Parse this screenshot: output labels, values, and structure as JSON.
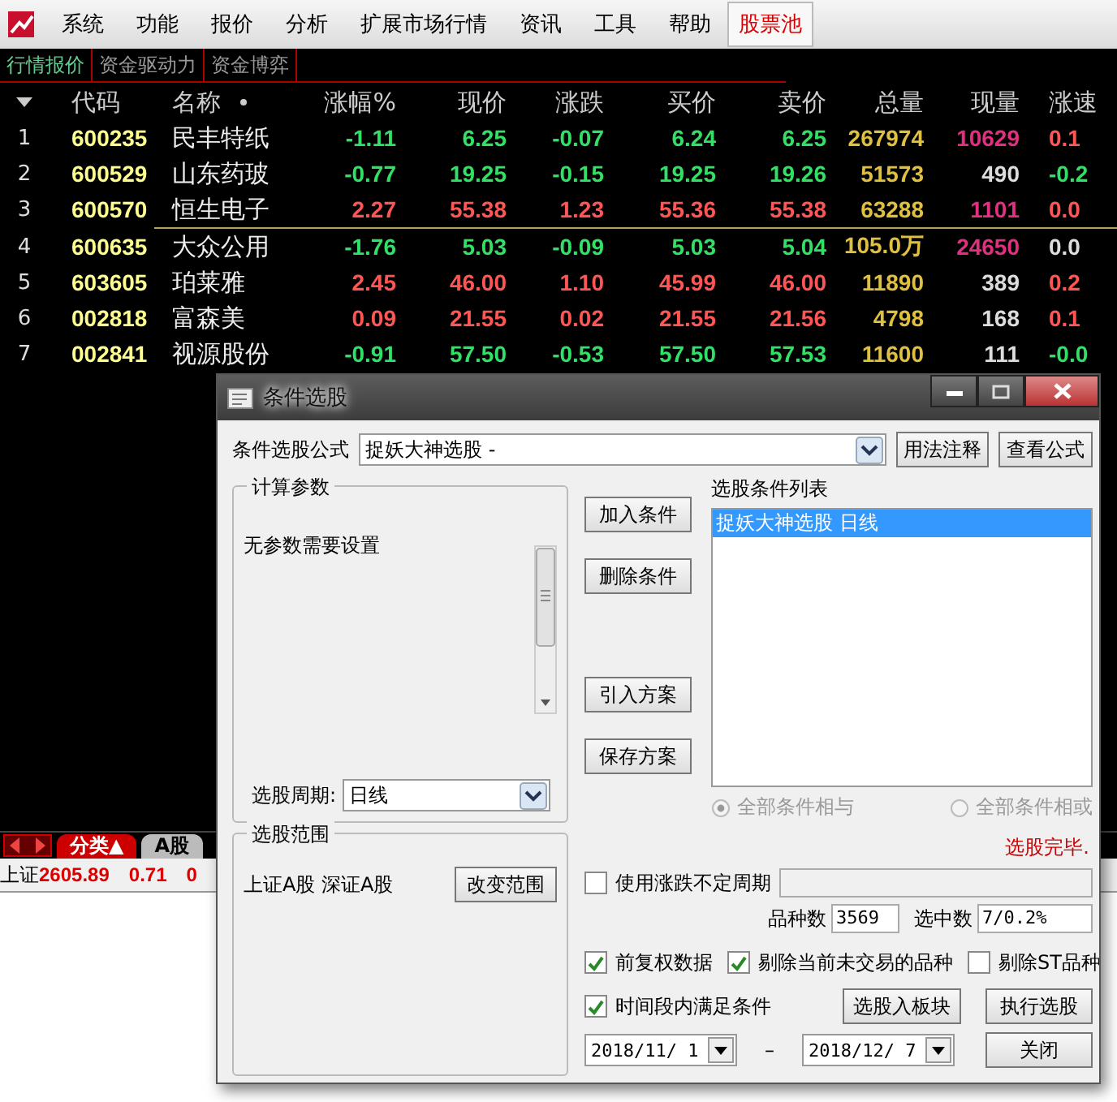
{
  "menu": [
    {
      "label": "系统",
      "kind": "normal"
    },
    {
      "label": "功能",
      "kind": "normal"
    },
    {
      "label": "报价",
      "kind": "normal"
    },
    {
      "label": "分析",
      "kind": "normal"
    },
    {
      "label": "扩展市场行情",
      "kind": "normal"
    },
    {
      "label": "资讯",
      "kind": "normal"
    },
    {
      "label": "工具",
      "kind": "normal"
    },
    {
      "label": "帮助",
      "kind": "normal"
    },
    {
      "label": "股票池",
      "kind": "highlight"
    }
  ],
  "tabs": [
    {
      "label": "行情报价",
      "selected": true
    },
    {
      "label": "资金驱动力",
      "selected": false
    },
    {
      "label": "资金博弈",
      "selected": false
    }
  ],
  "table": {
    "columns": [
      "代码",
      "名称",
      "涨幅%",
      "现价",
      "涨跌",
      "买价",
      "卖价",
      "总量",
      "现量",
      "涨速"
    ],
    "rows": [
      {
        "rank": "1",
        "code": "600235",
        "name": "民丰特纸",
        "change_pct": "-1.11",
        "price": "6.25",
        "change": "-0.07",
        "bid": "6.24",
        "ask": "6.25",
        "volume": "267974",
        "current_volume": {
          "text": "10629",
          "color": "#e0307f"
        },
        "speed": {
          "text": "0.1",
          "color": "#ff5555"
        },
        "color": "#33e066",
        "separator_below": false
      },
      {
        "rank": "2",
        "code": "600529",
        "name": "山东药玻",
        "change_pct": "-0.77",
        "price": "19.25",
        "change": "-0.15",
        "bid": "19.25",
        "ask": "19.26",
        "volume": "51573",
        "current_volume": {
          "text": "490",
          "color": "#dddddd"
        },
        "speed": {
          "text": "-0.2",
          "color": "#33e066"
        },
        "color": "#33e066",
        "separator_below": false
      },
      {
        "rank": "3",
        "code": "600570",
        "name": "恒生电子",
        "change_pct": "2.27",
        "price": "55.38",
        "change": "1.23",
        "bid": "55.36",
        "ask": "55.38",
        "volume": "63288",
        "current_volume": {
          "text": "1101",
          "color": "#e0307f"
        },
        "speed": {
          "text": "0.0",
          "color": "#ff5555"
        },
        "color": "#ff5555",
        "separator_below": true
      },
      {
        "rank": "4",
        "code": "600635",
        "name": "大众公用",
        "change_pct": "-1.76",
        "price": "5.03",
        "change": "-0.09",
        "bid": "5.03",
        "ask": "5.04",
        "volume": "105.0万",
        "current_volume": {
          "text": "24650",
          "color": "#e0307f"
        },
        "speed": {
          "text": "0.0",
          "color": "#dddddd"
        },
        "color": "#33e066",
        "separator_below": false
      },
      {
        "rank": "5",
        "code": "603605",
        "name": "珀莱雅",
        "change_pct": "2.45",
        "price": "46.00",
        "change": "1.10",
        "bid": "45.99",
        "ask": "46.00",
        "volume": "11890",
        "current_volume": {
          "text": "389",
          "color": "#dddddd"
        },
        "speed": {
          "text": "0.2",
          "color": "#ff5555"
        },
        "color": "#ff5555",
        "separator_below": false
      },
      {
        "rank": "6",
        "code": "002818",
        "name": "富森美",
        "change_pct": "0.09",
        "price": "21.55",
        "change": "0.02",
        "bid": "21.55",
        "ask": "21.56",
        "volume": "4798",
        "current_volume": {
          "text": "168",
          "color": "#dddddd"
        },
        "speed": {
          "text": "0.1",
          "color": "#ff5555"
        },
        "color": "#ff5555",
        "separator_below": false
      },
      {
        "rank": "7",
        "code": "002841",
        "name": "视源股份",
        "change_pct": "-0.91",
        "price": "57.50",
        "change": "-0.53",
        "bid": "57.50",
        "ask": "57.53",
        "volume": "11600",
        "current_volume": {
          "text": "111",
          "color": "#dddddd"
        },
        "speed": {
          "text": "-0.0",
          "color": "#33e066"
        },
        "color": "#33e066",
        "separator_below": false
      }
    ]
  },
  "bottom_tabs": [
    {
      "label": "分类▲",
      "selected": true
    },
    {
      "label": "A股",
      "selected": false
    }
  ],
  "index_line": {
    "name": "上证",
    "value": "2605.89",
    "change": "0.71",
    "column_3": "0"
  },
  "dialog": {
    "title": "条件选股",
    "formula_label": "条件选股公式",
    "formula_value": "捉妖大神选股 -",
    "usage_button": "用法注释",
    "view_button": "查看公式",
    "params_group": {
      "title": "计算参数",
      "text": "无参数需要设置",
      "period_label": "选股周期:",
      "period_value": "日线"
    },
    "scope_group": {
      "title": "选股范围",
      "text": "上证A股 深证A股",
      "button": "改变范围"
    },
    "side_buttons": [
      "加入条件",
      "删除条件",
      "引入方案",
      "保存方案"
    ],
    "list_label": "选股条件列表",
    "list_items": [
      {
        "label": "捉妖大神选股   日线",
        "selected": true
      }
    ],
    "radios": [
      {
        "label": "全部条件相与",
        "selected": true,
        "disabled": true
      },
      {
        "label": "全部条件相或",
        "selected": false,
        "disabled": true
      }
    ],
    "status": "选股完毕.",
    "variable_period": {
      "label": "使用涨跌不定周期",
      "checked": false
    },
    "count_label": "品种数",
    "count_value": "3569",
    "selected_label": "选中数",
    "selected_value": "7/0.2%",
    "options": [
      {
        "label": "前复权数据",
        "checked": true
      },
      {
        "label": "剔除当前未交易的品种",
        "checked": true
      },
      {
        "label": "剔除ST品种",
        "checked": false
      }
    ],
    "time_range": {
      "label": "时间段内满足条件",
      "checked": true
    },
    "to_block_button": "选股入板块",
    "run_button": "执行选股",
    "date_from": "2018/11/ 1",
    "date_separator": "–",
    "date_to": "2018/12/ 7",
    "close_button": "关闭"
  }
}
